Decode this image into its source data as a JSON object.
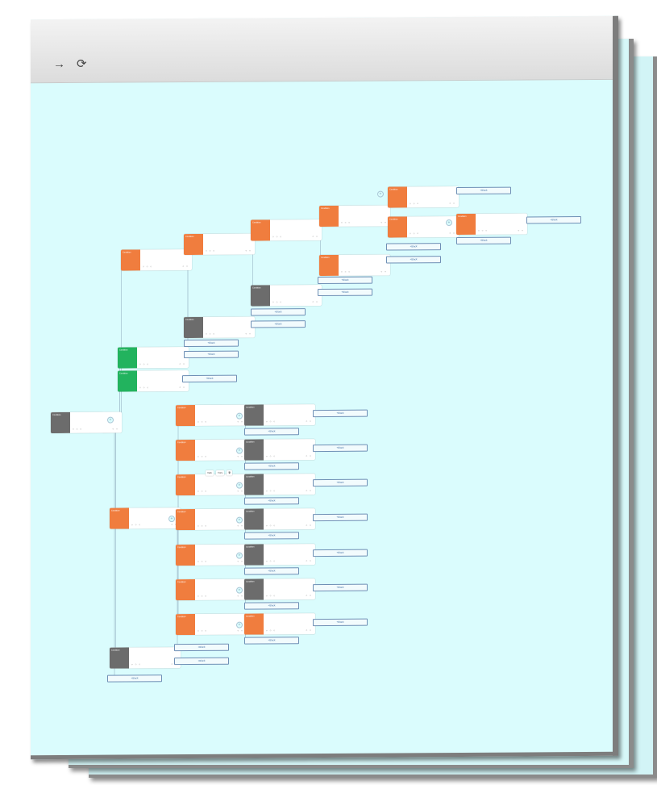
{
  "browser": {
    "forward_icon": "arrow-right-icon",
    "reload_icon": "reload-icon",
    "forward_glyph": "→",
    "reload_glyph": "⟳"
  },
  "colors": {
    "canvas": "#dafcfd",
    "orange": "#f07d3e",
    "gray": "#6c6c6c",
    "green": "#22b35e",
    "block_border": "#6e8fb5"
  },
  "labels": {
    "add_block": "+Block",
    "node_type": "Condition",
    "node_meta": "○ ○ ○",
    "node_meta_right": "○ ○"
  },
  "tooltip": {
    "a": "Hello",
    "b": "Copy"
  }
}
